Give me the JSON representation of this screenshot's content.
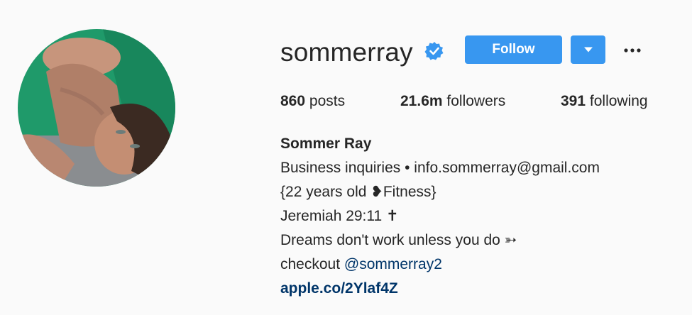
{
  "profile": {
    "username": "sommerray",
    "verified": true,
    "follow_label": "Follow",
    "more_label": "•••",
    "stats": {
      "posts_count": "860",
      "posts_label": "posts",
      "followers_count": "21.6m",
      "followers_label": "followers",
      "following_count": "391",
      "following_label": "following"
    },
    "bio": {
      "full_name": "Sommer Ray",
      "line1": "Business inquiries • info.sommerray@gmail.com",
      "line2": "{22 years old ❥Fitness}",
      "line3": "Jeremiah 29:11 ✝",
      "line4": "Dreams don't work unless you do ➳",
      "line5_prefix": "checkout ",
      "line5_mention": "@sommerray2",
      "link": "apple.co/2Ylaf4Z"
    }
  },
  "colors": {
    "primary_button": "#3897f0",
    "link": "#003569",
    "text": "#262626",
    "background": "#fafafa",
    "verified_badge": "#3897f0"
  },
  "icons": {
    "verified": "verified-badge-icon",
    "dropdown": "caret-down-icon",
    "more": "ellipsis-icon"
  }
}
